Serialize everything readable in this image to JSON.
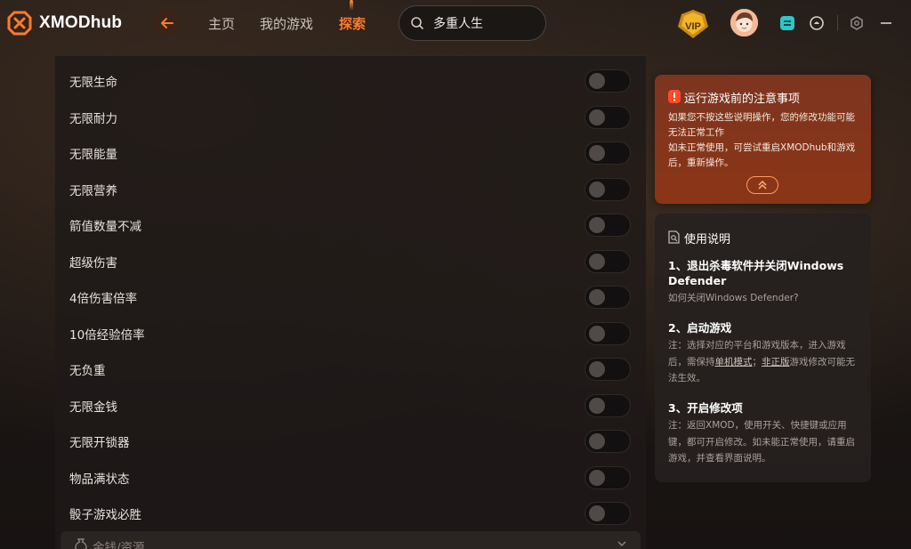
{
  "header": {
    "logo_text": "XMODhub",
    "nav": [
      {
        "label": "主页"
      },
      {
        "label": "我的游戏"
      },
      {
        "label": "探索"
      }
    ],
    "search_value": "多重人生",
    "vip_text": "VIP"
  },
  "mods": [
    {
      "label": "无限生命"
    },
    {
      "label": "无限耐力"
    },
    {
      "label": "无限能量"
    },
    {
      "label": "无限营养"
    },
    {
      "label": "箭值数量不减"
    },
    {
      "label": "超级伤害"
    },
    {
      "label": "4倍伤害倍率"
    },
    {
      "label": "10倍经验倍率"
    },
    {
      "label": "无负重"
    },
    {
      "label": "无限金钱"
    },
    {
      "label": "无限开锁器"
    },
    {
      "label": "物品满状态"
    },
    {
      "label": "骰子游戏必胜"
    }
  ],
  "section": {
    "label": "金钱/资源"
  },
  "notice": {
    "title": "运行游戏前的注意事项",
    "body1": "如果您不按这些说明操作，您的修改功能可能无法正常工作",
    "body2": "如未正常使用，可尝试重启XMODhub和游戏后，重新操作。"
  },
  "guide": {
    "title": "使用说明",
    "step1_title": "1、退出杀毒软件并关闭Windows Defender",
    "step1_body": "如何关闭Windows Defender?",
    "step2_title": "2、启动游戏",
    "step2_body_a": "注：选择对应的平台和游戏版本，进入游戏后，需保持",
    "step2_link1": "单机模式",
    "step2_body_b": "；",
    "step2_link2": "非正版",
    "step2_body_c": "游戏修改可能无法生效。",
    "step3_title": "3、开启修改项",
    "step3_body": "注：返回XMOD，使用开关、快捷键或应用键，都可开启修改。如未能正常使用，请重启游戏，并查看界面说明。"
  },
  "colors": {
    "accent": "#ff7a2e",
    "notice_bg": "#8b3516"
  }
}
